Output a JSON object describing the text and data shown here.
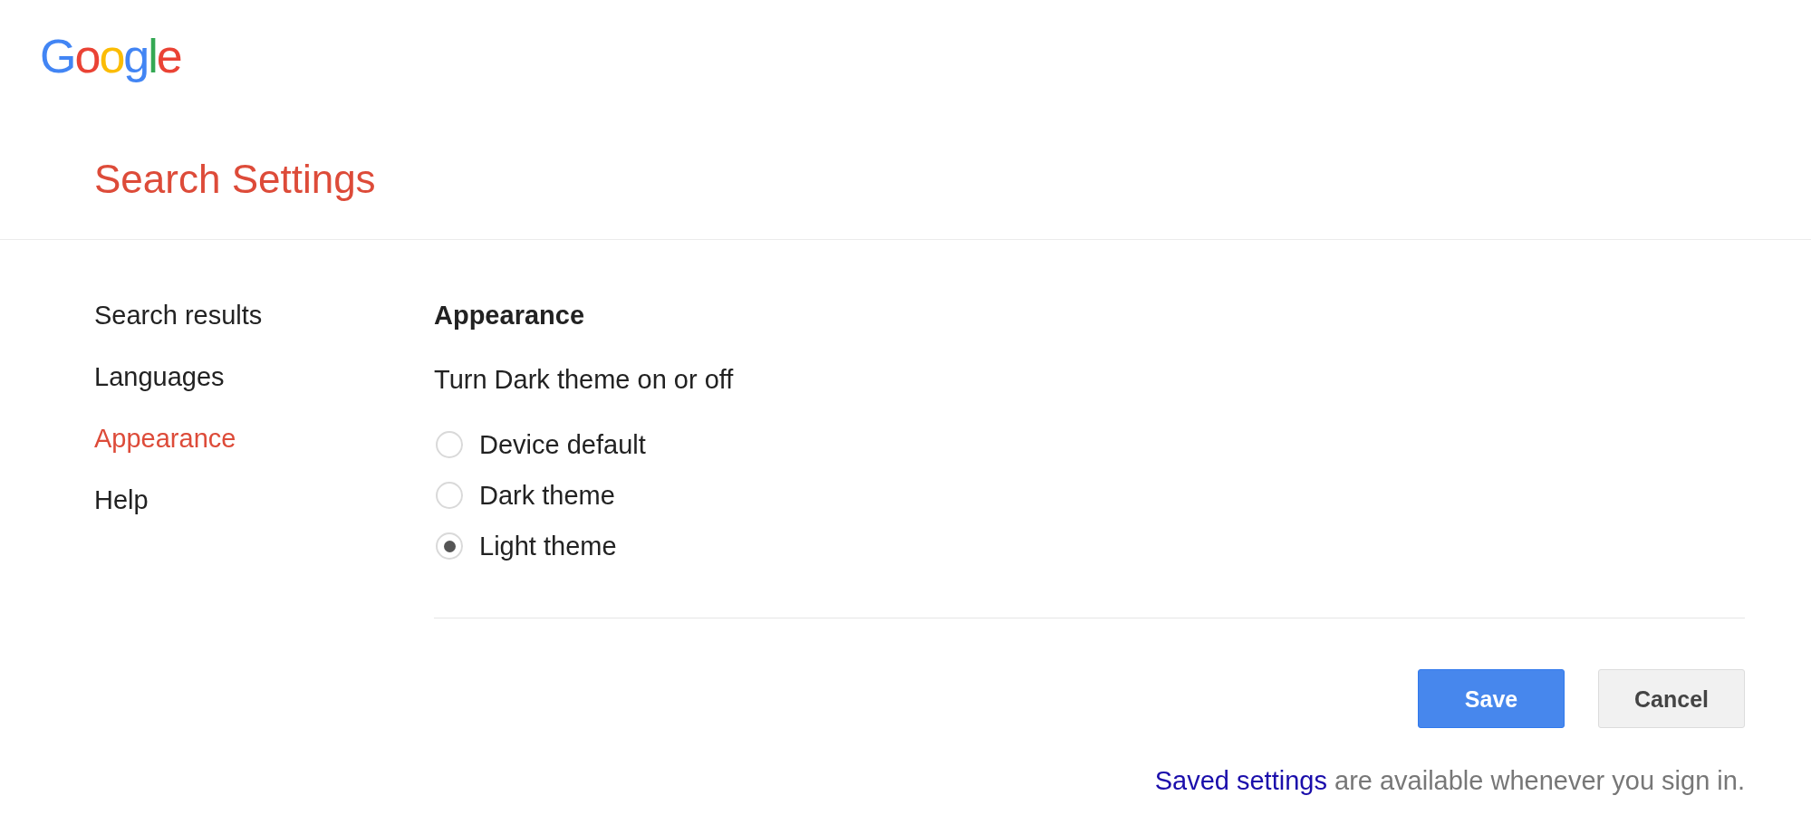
{
  "logo": "Google",
  "header": {
    "title": "Search Settings"
  },
  "sidebar": {
    "items": [
      {
        "label": "Search results",
        "selected": false
      },
      {
        "label": "Languages",
        "selected": false
      },
      {
        "label": "Appearance",
        "selected": true
      },
      {
        "label": "Help",
        "selected": false
      }
    ]
  },
  "section": {
    "heading": "Appearance",
    "description": "Turn Dark theme on or off",
    "options": [
      {
        "label": "Device default",
        "selected": false
      },
      {
        "label": "Dark theme",
        "selected": false
      },
      {
        "label": "Light theme",
        "selected": true
      }
    ]
  },
  "buttons": [
    {
      "label": "Save",
      "kind": "primary"
    },
    {
      "label": "Cancel",
      "kind": "secondary"
    }
  ],
  "footer": {
    "link": "Saved settings",
    "text": "are available whenever you sign in."
  }
}
